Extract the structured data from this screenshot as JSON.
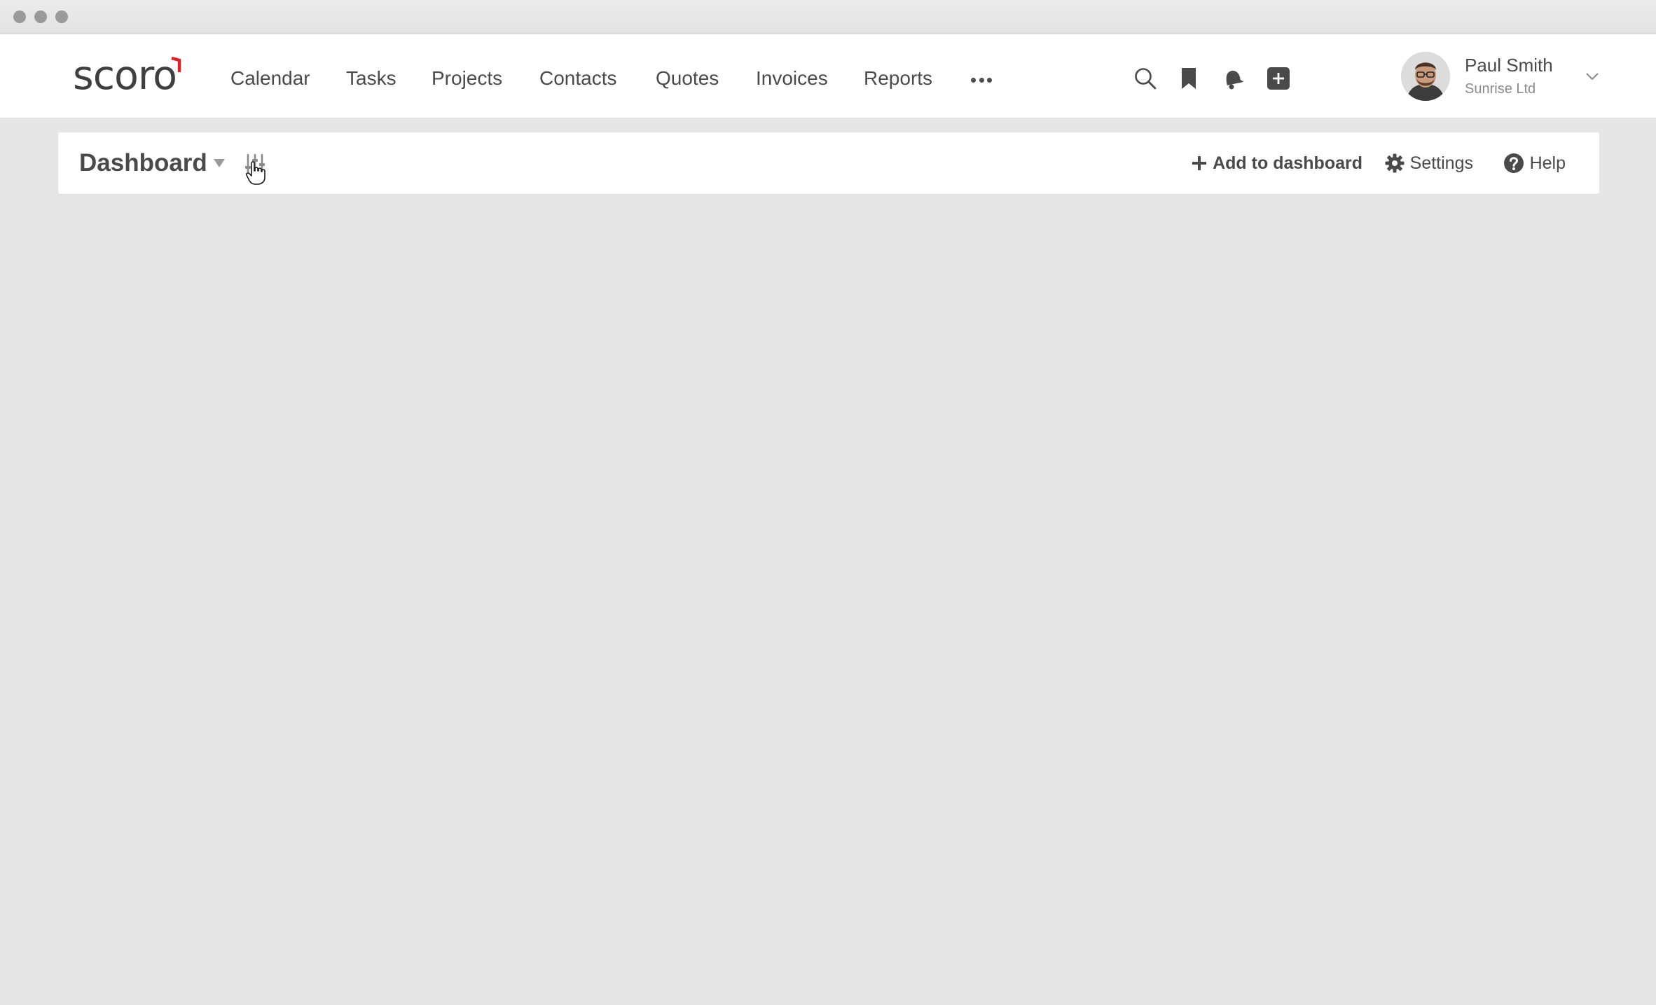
{
  "window": {
    "controls": [
      "close",
      "minimize",
      "maximize"
    ]
  },
  "brand": {
    "logo_text": "scoro",
    "accent_color": "#d8232a"
  },
  "nav": {
    "items": [
      {
        "label": "Calendar"
      },
      {
        "label": "Tasks"
      },
      {
        "label": "Projects"
      },
      {
        "label": "Contacts"
      },
      {
        "label": "Quotes"
      },
      {
        "label": "Invoices"
      },
      {
        "label": "Reports"
      }
    ],
    "more_icon": "ellipsis-icon"
  },
  "toolbar_icons": [
    "search-icon",
    "bookmark-icon",
    "bell-icon",
    "add-icon"
  ],
  "user": {
    "name": "Paul Smith",
    "company": "Sunrise Ltd"
  },
  "dashboard": {
    "title": "Dashboard",
    "actions": {
      "add_label": "Add to dashboard",
      "settings_label": "Settings",
      "help_label": "Help"
    }
  },
  "colors": {
    "page_background": "#e6e6e6",
    "text": "#4a4a4a"
  }
}
